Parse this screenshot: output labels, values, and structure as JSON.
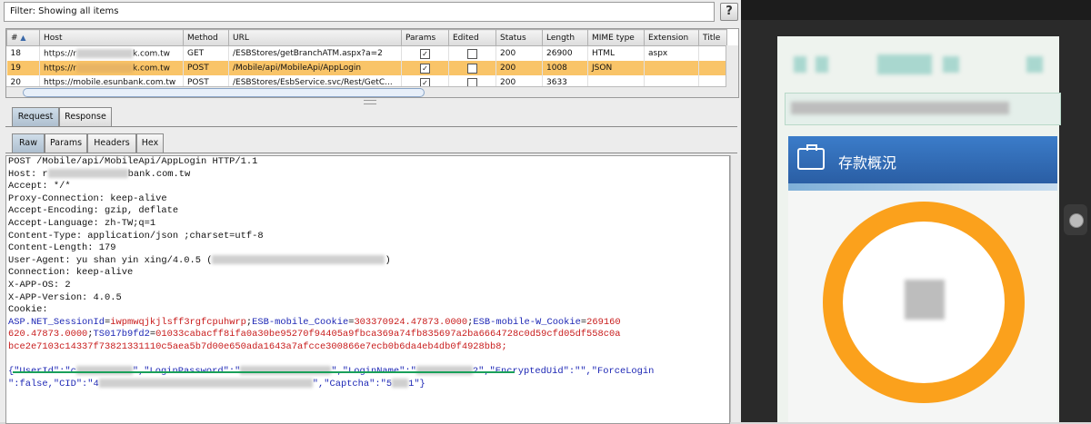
{
  "filter": {
    "text": "Filter:  Showing all items"
  },
  "help_label": "?",
  "table": {
    "columns": [
      "#",
      "Host",
      "Method",
      "URL",
      "Params",
      "Edited",
      "Status",
      "Length",
      "MIME type",
      "Extension",
      "Title"
    ],
    "rows": [
      {
        "num": "18",
        "host_pre": "https://r",
        "host_post": "k.com.tw",
        "method": "GET",
        "url": "/ESBStores/getBranchATM.aspx?a=2",
        "params_checked": true,
        "edited_checked": false,
        "status": "200",
        "length": "26900",
        "mime": "HTML",
        "ext": "aspx",
        "title": ""
      },
      {
        "num": "19",
        "host_pre": "https://r",
        "host_post": "k.com.tw",
        "method": "POST",
        "url": "/Mobile/api/MobileApi/AppLogin",
        "params_checked": true,
        "edited_checked": false,
        "status": "200",
        "length": "1008",
        "mime": "JSON",
        "ext": "",
        "title": ""
      },
      {
        "num": "20",
        "host_pre": "https://mobile.esunbank.com.tw",
        "host_post": "",
        "method": "POST",
        "url": "/ESBStores/EsbService.svc/Rest/GetC...",
        "params_checked": true,
        "edited_checked": false,
        "status": "200",
        "length": "3633",
        "mime": "",
        "ext": "",
        "title": ""
      }
    ]
  },
  "tabs_top": {
    "request": "Request",
    "response": "Response"
  },
  "tabs_sub": {
    "raw": "Raw",
    "params": "Params",
    "headers": "Headers",
    "hex": "Hex"
  },
  "raw": {
    "l1": "POST /Mobile/api/MobileApi/AppLogin HTTP/1.1",
    "l2a": "Host: r",
    "l2b": "bank.com.tw",
    "l3": "Accept: */*",
    "l4": "Proxy-Connection: keep-alive",
    "l5": "Accept-Encoding: gzip, deflate",
    "l6": "Accept-Language: zh-TW;q=1",
    "l7": "Content-Type: application/json ;charset=utf-8",
    "l8": "Content-Length: 179",
    "l9a": "User-Agent: yu shan yin xing/4.0.5 (",
    "l9b": ")",
    "l10": "Connection: keep-alive",
    "l11": "X-APP-OS: 2",
    "l12": "X-APP-Version: 4.0.5",
    "l13": "Cookie:",
    "c1k": "ASP.NET_SessionId",
    "c1v": "iwpmwqjkjlsff3rgfcpuhwrp",
    "c2k": "ESB-mobile_Cookie",
    "c2v": "303370924.47873.0000",
    "c3k": "ESB-mobile-W_Cookie",
    "c3v": "269160",
    "c3v2": "620.47873.0000",
    "c4k": "TS017b9fd2",
    "c4v": "01033cabacff8ifa0a30be95270f94405a9fbca369a74fb835697a2ba6664728c0d59cfd05df558c0a",
    "c4v2": "bce2e7103c14337f73821331110c5aea5b7d00e650ada1643a7afcce300866e7ecb0b6da4eb4db0f4928bb8;",
    "b1": "{\"UserId\":\"c",
    "b2": "\",\"LoginPassword\":\"",
    "b3": "\",\"LoginName\":\"",
    "b4": "2\",\"EncryptedUid\":\"\",\"ForceLogin",
    "b5": "\":false,\"CID\":\"4",
    "b6": "\",\"Captcha\":\"5",
    "b7": "1\"}"
  },
  "phone": {
    "card_title": "存款概況"
  }
}
